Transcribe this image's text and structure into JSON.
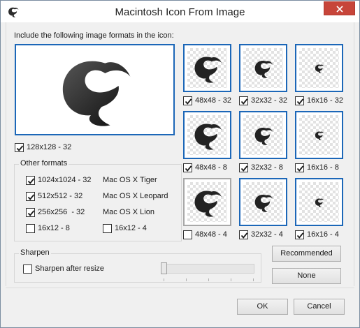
{
  "window": {
    "title": "Macintosh Icon From Image"
  },
  "instructions": "Include the following image formats in the icon:",
  "large_preview": {
    "label": "128x128 - 32",
    "checked": true
  },
  "grid": [
    {
      "label": "48x48 - 32",
      "checked": true
    },
    {
      "label": "32x32 - 32",
      "checked": true
    },
    {
      "label": "16x16 - 32",
      "checked": true
    },
    {
      "label": "48x48 - 8",
      "checked": true
    },
    {
      "label": "32x32 - 8",
      "checked": true
    },
    {
      "label": "16x16 - 8",
      "checked": true
    },
    {
      "label": "48x48 - 4",
      "checked": false
    },
    {
      "label": "32x32 - 4",
      "checked": true
    },
    {
      "label": "16x16 - 4",
      "checked": true
    }
  ],
  "other_formats": {
    "title": "Other formats",
    "items": [
      {
        "label": "1024x1024 - 32",
        "note": "Mac OS X Tiger",
        "checked": true
      },
      {
        "label": "512x512 - 32",
        "note": "Mac OS X Leopard",
        "checked": true
      },
      {
        "label": "256x256  - 32",
        "note": "Mac OS X Lion",
        "checked": true
      },
      {
        "label": "16x12 - 8",
        "checked": false
      },
      {
        "label": "16x12 - 4",
        "checked": false
      }
    ]
  },
  "sharpen": {
    "title": "Sharpen",
    "checkbox_label": "Sharpen after resize",
    "checked": false,
    "level": 0
  },
  "buttons": {
    "recommended": "Recommended",
    "none": "None",
    "ok": "OK",
    "cancel": "Cancel"
  },
  "colors": {
    "accent": "#1c67b8",
    "close": "#c7453a"
  },
  "icons": {
    "app": "app-logo-icon",
    "close": "close-icon",
    "check": "checkmark-icon"
  }
}
